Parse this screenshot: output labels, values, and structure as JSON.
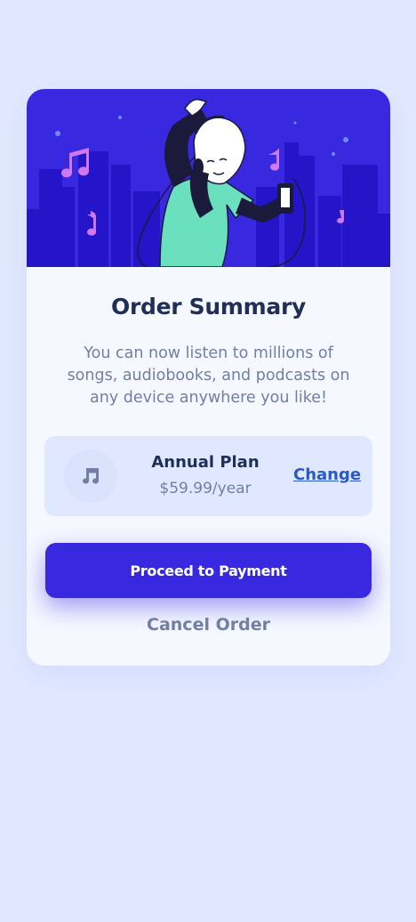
{
  "card": {
    "title": "Order Summary",
    "description": "You can now listen to millions of songs, audiobooks, and podcasts on any device anywhere you like!"
  },
  "plan": {
    "icon": "music-note-icon",
    "name": "Annual Plan",
    "price": "$59.99/year",
    "change_label": "Change"
  },
  "actions": {
    "proceed_label": "Proceed to Payment",
    "cancel_label": "Cancel Order"
  },
  "colors": {
    "page_background": "#e0e8ff",
    "card_background": "#f5f8ff",
    "accent": "#3829e0",
    "heading": "#1f2f56",
    "muted": "#717fa6",
    "link": "#2a59c7"
  }
}
